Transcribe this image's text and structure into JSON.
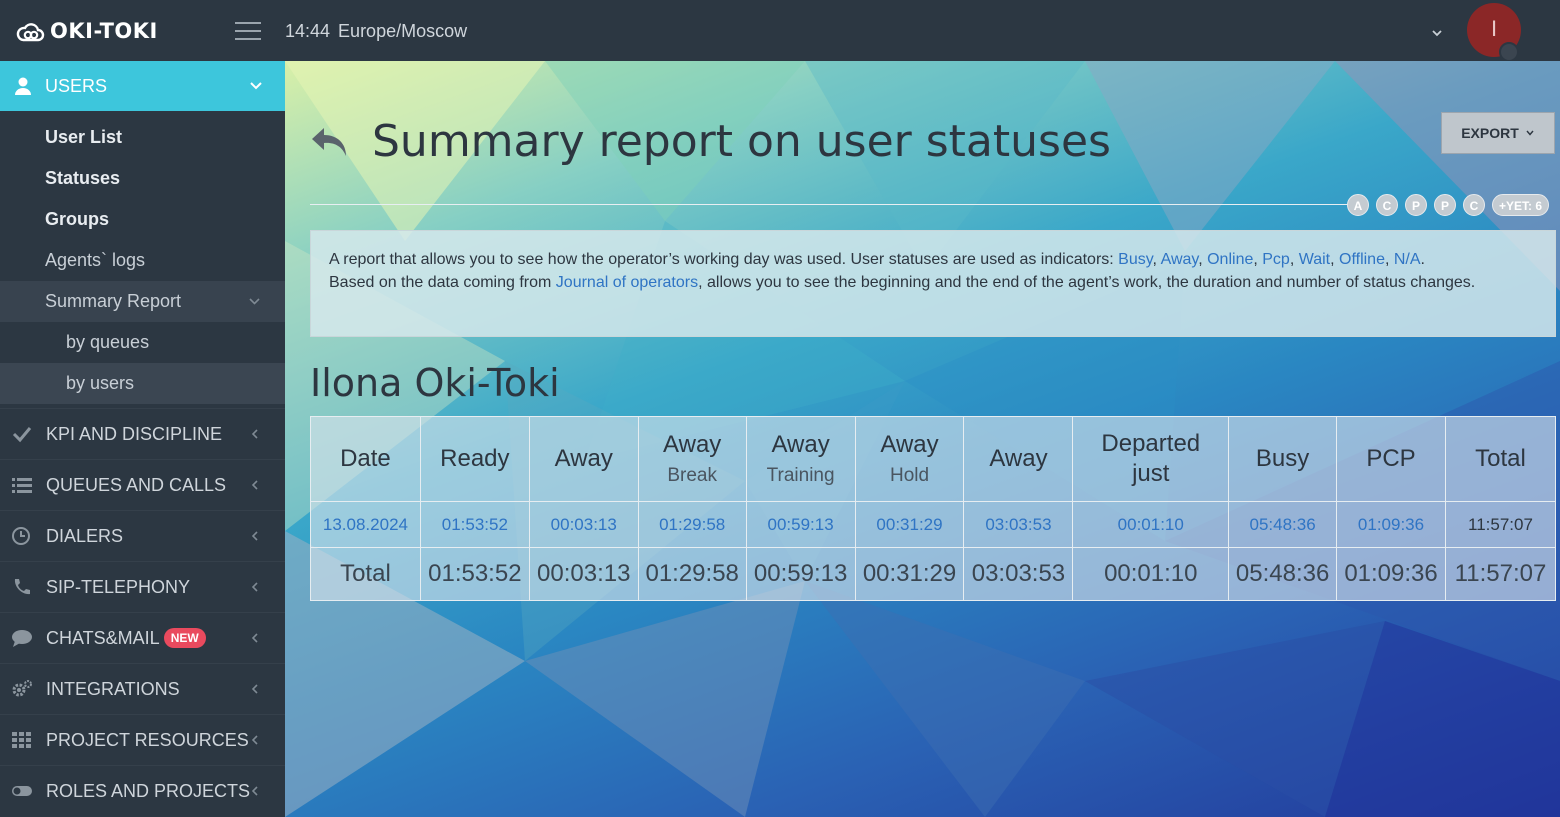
{
  "topbar": {
    "logo": "OKI-TOKI",
    "time": "14:44",
    "timezone": "Europe/Moscow",
    "avatar_initial": "I"
  },
  "sidebar": {
    "users_label": "USERS",
    "submenu": [
      {
        "label": "User List"
      },
      {
        "label": "Statuses"
      },
      {
        "label": "Groups"
      },
      {
        "label": "Agents` logs"
      },
      {
        "label": "Summary Report"
      },
      {
        "label": "by queues"
      },
      {
        "label": "by users"
      }
    ],
    "nav": [
      {
        "label": "KPI AND DISCIPLINE"
      },
      {
        "label": "QUEUES AND CALLS"
      },
      {
        "label": "DIALERS"
      },
      {
        "label": "SIP-TELEPHONY"
      },
      {
        "label": "CHATS&MAIL",
        "badge": "NEW"
      },
      {
        "label": "INTEGRATIONS"
      },
      {
        "label": "PROJECT RESOURCES"
      },
      {
        "label": "ROLES AND PROJECTS"
      }
    ]
  },
  "main": {
    "title": "Summary report on user statuses",
    "export_label": "EXPORT",
    "chips": [
      "A",
      "C",
      "P",
      "P",
      "C"
    ],
    "chip_more": "+YET: 6",
    "info": {
      "p1": "A report that allows you to see how the operator’s working day was used. User statuses are used as indicators: ",
      "links": [
        "Busy",
        "Away",
        "Online",
        "Pcp",
        "Wait",
        "Offline",
        "N/A"
      ],
      "sep": ", ",
      "end1": ".",
      "p2": "Based on the data coming from ",
      "journal_link": "Journal of operators",
      "p3": ", allows you to see the beginning and the end of the agent’s work, the duration and number of status changes."
    },
    "person": "Ilona Oki-Toki",
    "table": {
      "headers": [
        {
          "main": "Date",
          "sub": ""
        },
        {
          "main": "Ready",
          "sub": ""
        },
        {
          "main": "Away",
          "sub": ""
        },
        {
          "main": "Away",
          "sub": "Break"
        },
        {
          "main": "Away",
          "sub": "Training"
        },
        {
          "main": "Away",
          "sub": "Hold"
        },
        {
          "main": "Away",
          "sub": ""
        },
        {
          "main": "Departed",
          "sub": "just"
        },
        {
          "main": "Busy",
          "sub": ""
        },
        {
          "main": "PCP",
          "sub": ""
        },
        {
          "main": "Total",
          "sub": ""
        }
      ],
      "row": [
        "13.08.2024",
        "01:53:52",
        "00:03:13",
        "01:29:58",
        "00:59:13",
        "00:31:29",
        "03:03:53",
        "00:01:10",
        "05:48:36",
        "01:09:36",
        "11:57:07"
      ],
      "total": [
        "Total",
        "01:53:52",
        "00:03:13",
        "01:29:58",
        "00:59:13",
        "00:31:29",
        "03:03:53",
        "00:01:10",
        "05:48:36",
        "01:09:36",
        "11:57:07"
      ]
    }
  }
}
